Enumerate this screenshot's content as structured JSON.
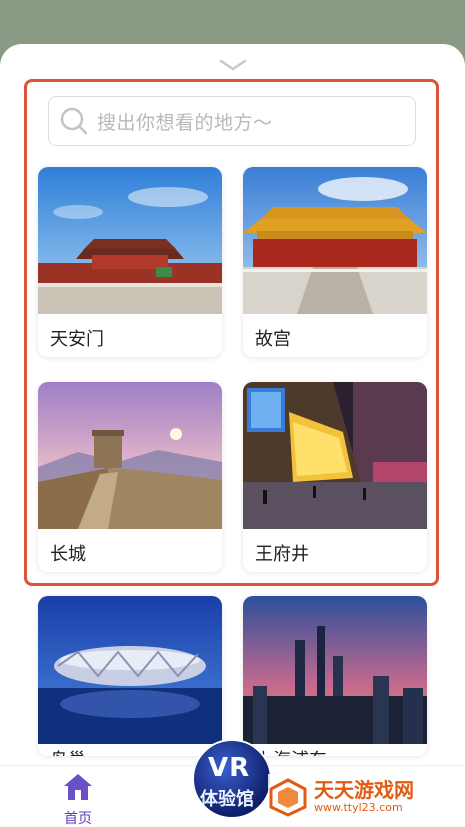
{
  "search": {
    "placeholder": "搜出你想看的地方～"
  },
  "places": [
    {
      "name": "天安门"
    },
    {
      "name": "故宫"
    },
    {
      "name": "长城"
    },
    {
      "name": "王府井"
    },
    {
      "name": "鸟巢"
    },
    {
      "name": "上海浦东"
    }
  ],
  "navbar": {
    "home_label": "首页"
  },
  "vr_badge": {
    "line1": "VR",
    "line2": "体验馆"
  },
  "watermark": {
    "name": "天天游戏网",
    "url": "www.ttyl23.com"
  },
  "colors": {
    "highlight": "#d9553a",
    "accent": "#5b3fb0",
    "watermark": "#e35a12",
    "backdrop": "#8a9a84"
  }
}
